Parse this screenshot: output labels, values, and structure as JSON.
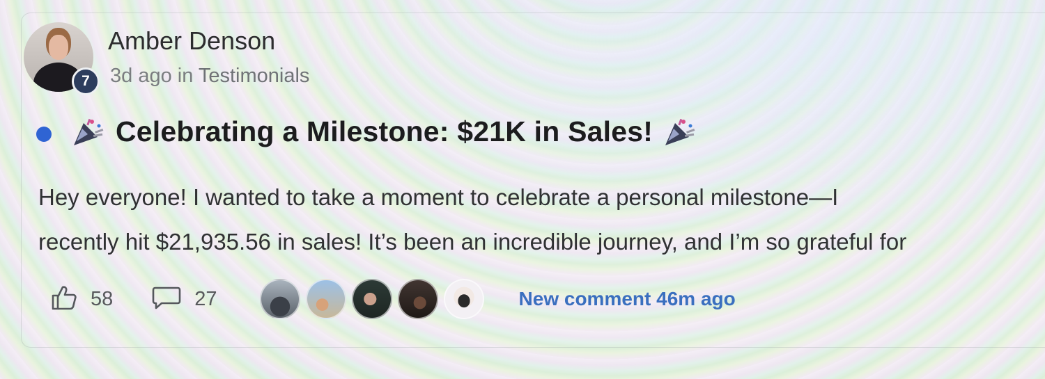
{
  "post": {
    "author": {
      "name": "Amber Denson",
      "level": "7"
    },
    "meta": {
      "time": "3d ago in",
      "category": "Testimonials"
    },
    "unread_dot_color": "#2f64d3",
    "title": "Celebrating a Milestone: $21K in Sales!",
    "title_icon": "party-popper-icon",
    "body_lines": [
      "Hey everyone! I wanted to take a moment to celebrate a personal milestone—I",
      "recently hit $21,935.56 in sales! It’s been an incredible journey, and I’m so grateful for"
    ],
    "likes": "58",
    "comments": "27",
    "like_icon": "thumbs-up-icon",
    "comment_icon": "comment-bubble-icon",
    "commenter_avatars": [
      {
        "name": "commenter-avatar-1",
        "color": "#4c5560"
      },
      {
        "name": "commenter-avatar-2",
        "color": "#7a9cc0"
      },
      {
        "name": "commenter-avatar-3",
        "color": "#2c3a36"
      },
      {
        "name": "commenter-avatar-4",
        "color": "#3a2f2a"
      },
      {
        "name": "commenter-avatar-5",
        "color": "#e7e4e8"
      }
    ],
    "last_comment": "New comment 46m ago",
    "accent_color": "#3a6fbf"
  }
}
